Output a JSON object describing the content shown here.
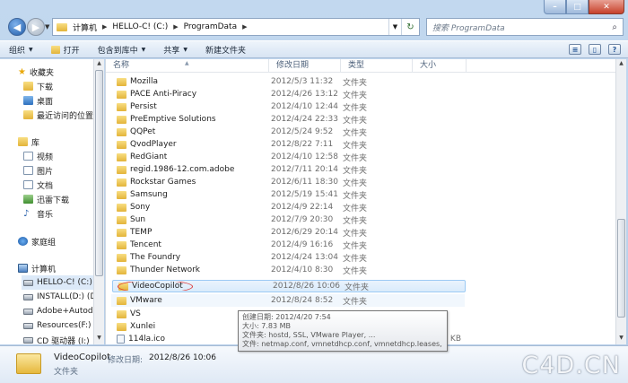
{
  "caption": {
    "minimize": "–",
    "maximize": "□",
    "close": "✕"
  },
  "address": {
    "crumbs": [
      "计算机",
      "HELLO-C! (C:)",
      "ProgramData"
    ],
    "refresh": "↻"
  },
  "search": {
    "placeholder": "搜索 ProgramData"
  },
  "toolbar": {
    "organize": "组织",
    "open": "打开",
    "include_in_library": "包含到库中",
    "share": "共享",
    "new_folder": "新建文件夹"
  },
  "nav": {
    "favorites": "收藏夹",
    "downloads": "下载",
    "desktop": "桌面",
    "recent": "最近访问的位置",
    "libraries": "库",
    "videos": "视频",
    "pictures": "图片",
    "documents": "文档",
    "thunder": "迅雷下载",
    "music": "音乐",
    "homegroup": "家庭组",
    "computer": "计算机",
    "drive_c": "HELLO-C! (C:)",
    "drive_d": "INSTALL(D:) (D:)",
    "drive_e": "Adobe+Autodesk",
    "drive_f": "Resources(F:) (F",
    "drive_cd": "CD 驱动器 (I:)"
  },
  "columns": {
    "name": "名称",
    "date": "修改日期",
    "type": "类型",
    "size": "大小"
  },
  "files": [
    {
      "name": "Mozilla",
      "date": "2012/5/3 11:32",
      "type": "文件夹",
      "size": ""
    },
    {
      "name": "PACE Anti-Piracy",
      "date": "2012/4/26 13:12",
      "type": "文件夹",
      "size": ""
    },
    {
      "name": "Persist",
      "date": "2012/4/10 12:44",
      "type": "文件夹",
      "size": ""
    },
    {
      "name": "PreEmptive Solutions",
      "date": "2012/4/24 22:33",
      "type": "文件夹",
      "size": ""
    },
    {
      "name": "QQPet",
      "date": "2012/5/24 9:52",
      "type": "文件夹",
      "size": ""
    },
    {
      "name": "QvodPlayer",
      "date": "2012/8/22 7:11",
      "type": "文件夹",
      "size": ""
    },
    {
      "name": "RedGiant",
      "date": "2012/4/10 12:58",
      "type": "文件夹",
      "size": ""
    },
    {
      "name": "regid.1986-12.com.adobe",
      "date": "2012/7/11 20:14",
      "type": "文件夹",
      "size": ""
    },
    {
      "name": "Rockstar Games",
      "date": "2012/6/11 18:30",
      "type": "文件夹",
      "size": ""
    },
    {
      "name": "Samsung",
      "date": "2012/5/19 15:41",
      "type": "文件夹",
      "size": ""
    },
    {
      "name": "Sony",
      "date": "2012/4/9 22:14",
      "type": "文件夹",
      "size": ""
    },
    {
      "name": "Sun",
      "date": "2012/7/9 20:30",
      "type": "文件夹",
      "size": ""
    },
    {
      "name": "TEMP",
      "date": "2012/6/29 20:14",
      "type": "文件夹",
      "size": ""
    },
    {
      "name": "Tencent",
      "date": "2012/4/9 16:16",
      "type": "文件夹",
      "size": ""
    },
    {
      "name": "The Foundry",
      "date": "2012/4/24 13:04",
      "type": "文件夹",
      "size": ""
    },
    {
      "name": "Thunder Network",
      "date": "2012/4/10 8:30",
      "type": "文件夹",
      "size": ""
    },
    {
      "name": "VideoCopilot",
      "date": "2012/8/26 10:06",
      "type": "文件夹",
      "size": ""
    },
    {
      "name": "VMware",
      "date": "2012/8/24 8:52",
      "type": "文件夹",
      "size": ""
    },
    {
      "name": "VS",
      "date": "",
      "type": "",
      "size": ""
    },
    {
      "name": "Xunlei",
      "date": "",
      "type": "",
      "size": ""
    },
    {
      "name": "114la.ico",
      "date": "",
      "type": "",
      "size": "4 KB"
    }
  ],
  "tooltip": {
    "created": "创建日期: 2012/4/20 7:54",
    "size": "大小: 7.83 MB",
    "folders": "文件夹: hostd, SSL, VMware Player, ...",
    "files": "文件: netmap.conf, vmnetdhcp.conf, vmnetdhcp.leases, ..."
  },
  "details": {
    "name": "VideoCopilot",
    "modified_label": "修改日期:",
    "modified_value": "2012/8/26 10:06",
    "type": "文件夹"
  },
  "watermark": "C4D.CN"
}
